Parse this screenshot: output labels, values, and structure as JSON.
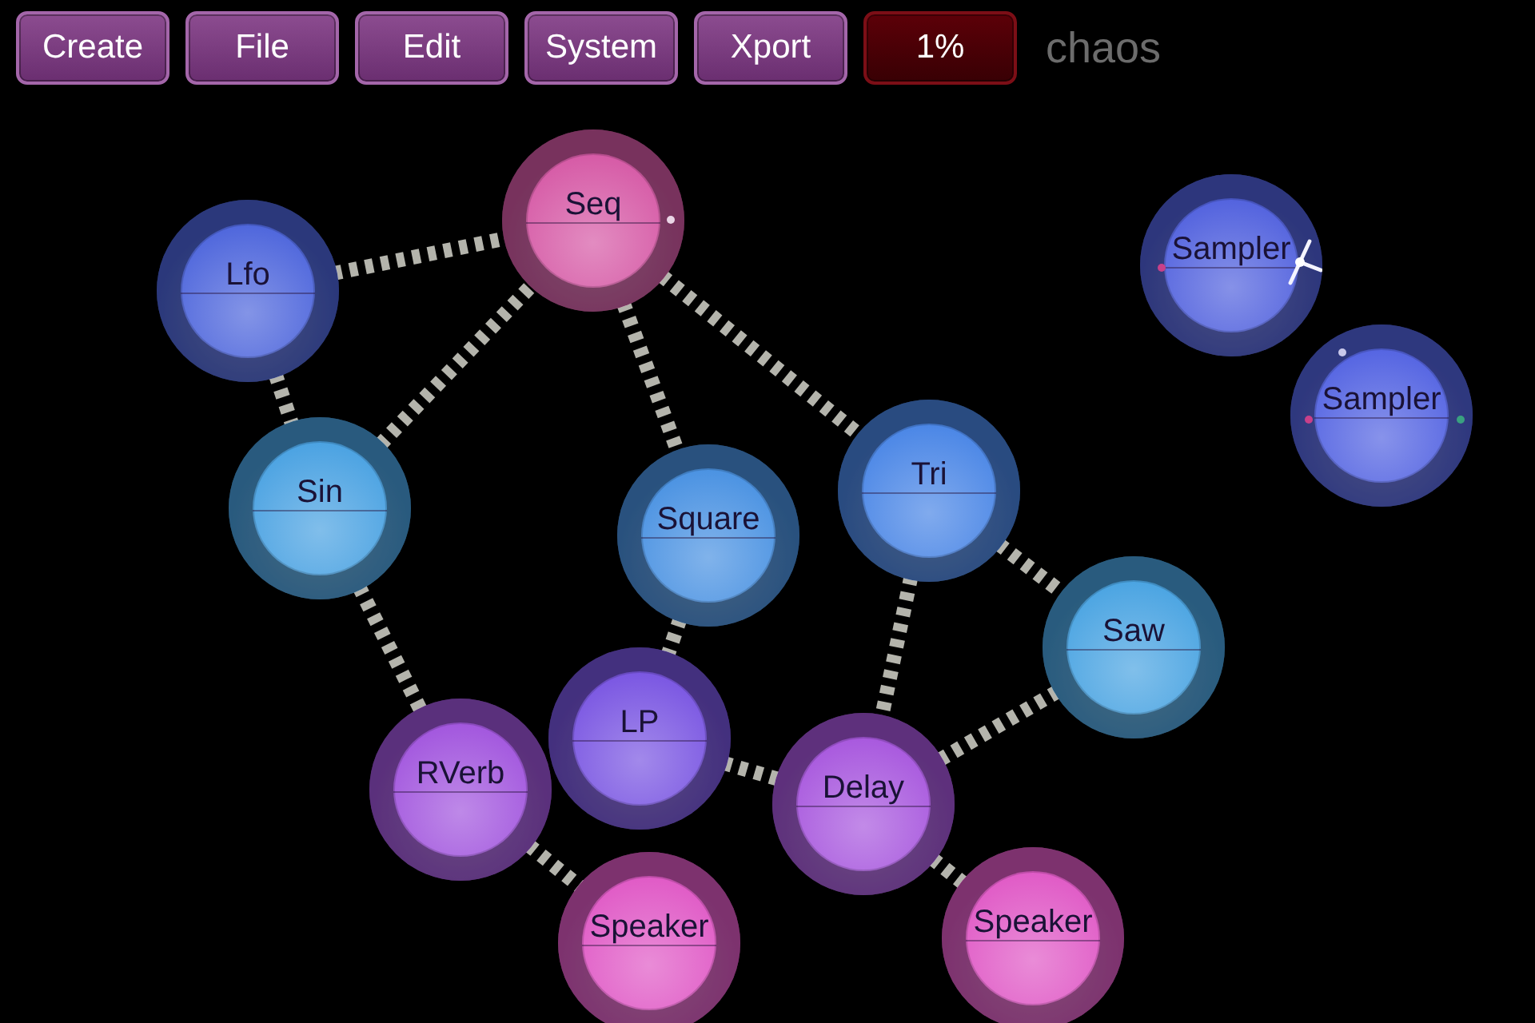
{
  "toolbar": {
    "buttons": [
      {
        "label": "Create",
        "kind": "menu"
      },
      {
        "label": "File",
        "kind": "menu"
      },
      {
        "label": "Edit",
        "kind": "menu"
      },
      {
        "label": "System",
        "kind": "menu"
      },
      {
        "label": "Xport",
        "kind": "menu"
      },
      {
        "label": "1%",
        "kind": "meter"
      }
    ],
    "patch_name": "chaos"
  },
  "nodes": [
    {
      "label": "Seq",
      "color": "#d65aa6"
    },
    {
      "label": "Lfo",
      "color": "#4e66dc"
    },
    {
      "label": "Sampler",
      "color": "#5262de"
    },
    {
      "label": "Sin",
      "color": "#4aa2e2"
    },
    {
      "label": "Square",
      "color": "#4a92e2"
    },
    {
      "label": "Tri",
      "color": "#4a86e6"
    },
    {
      "label": "Sampler",
      "color": "#5464e2"
    },
    {
      "label": "Saw",
      "color": "#4aa4e2"
    },
    {
      "label": "LP",
      "color": "#7a56e2"
    },
    {
      "label": "RVerb",
      "color": "#a256de"
    },
    {
      "label": "Delay",
      "color": "#a858de"
    },
    {
      "label": "Speaker",
      "color": "#e05ac6"
    },
    {
      "label": "Speaker",
      "color": "#e05ac6"
    }
  ]
}
